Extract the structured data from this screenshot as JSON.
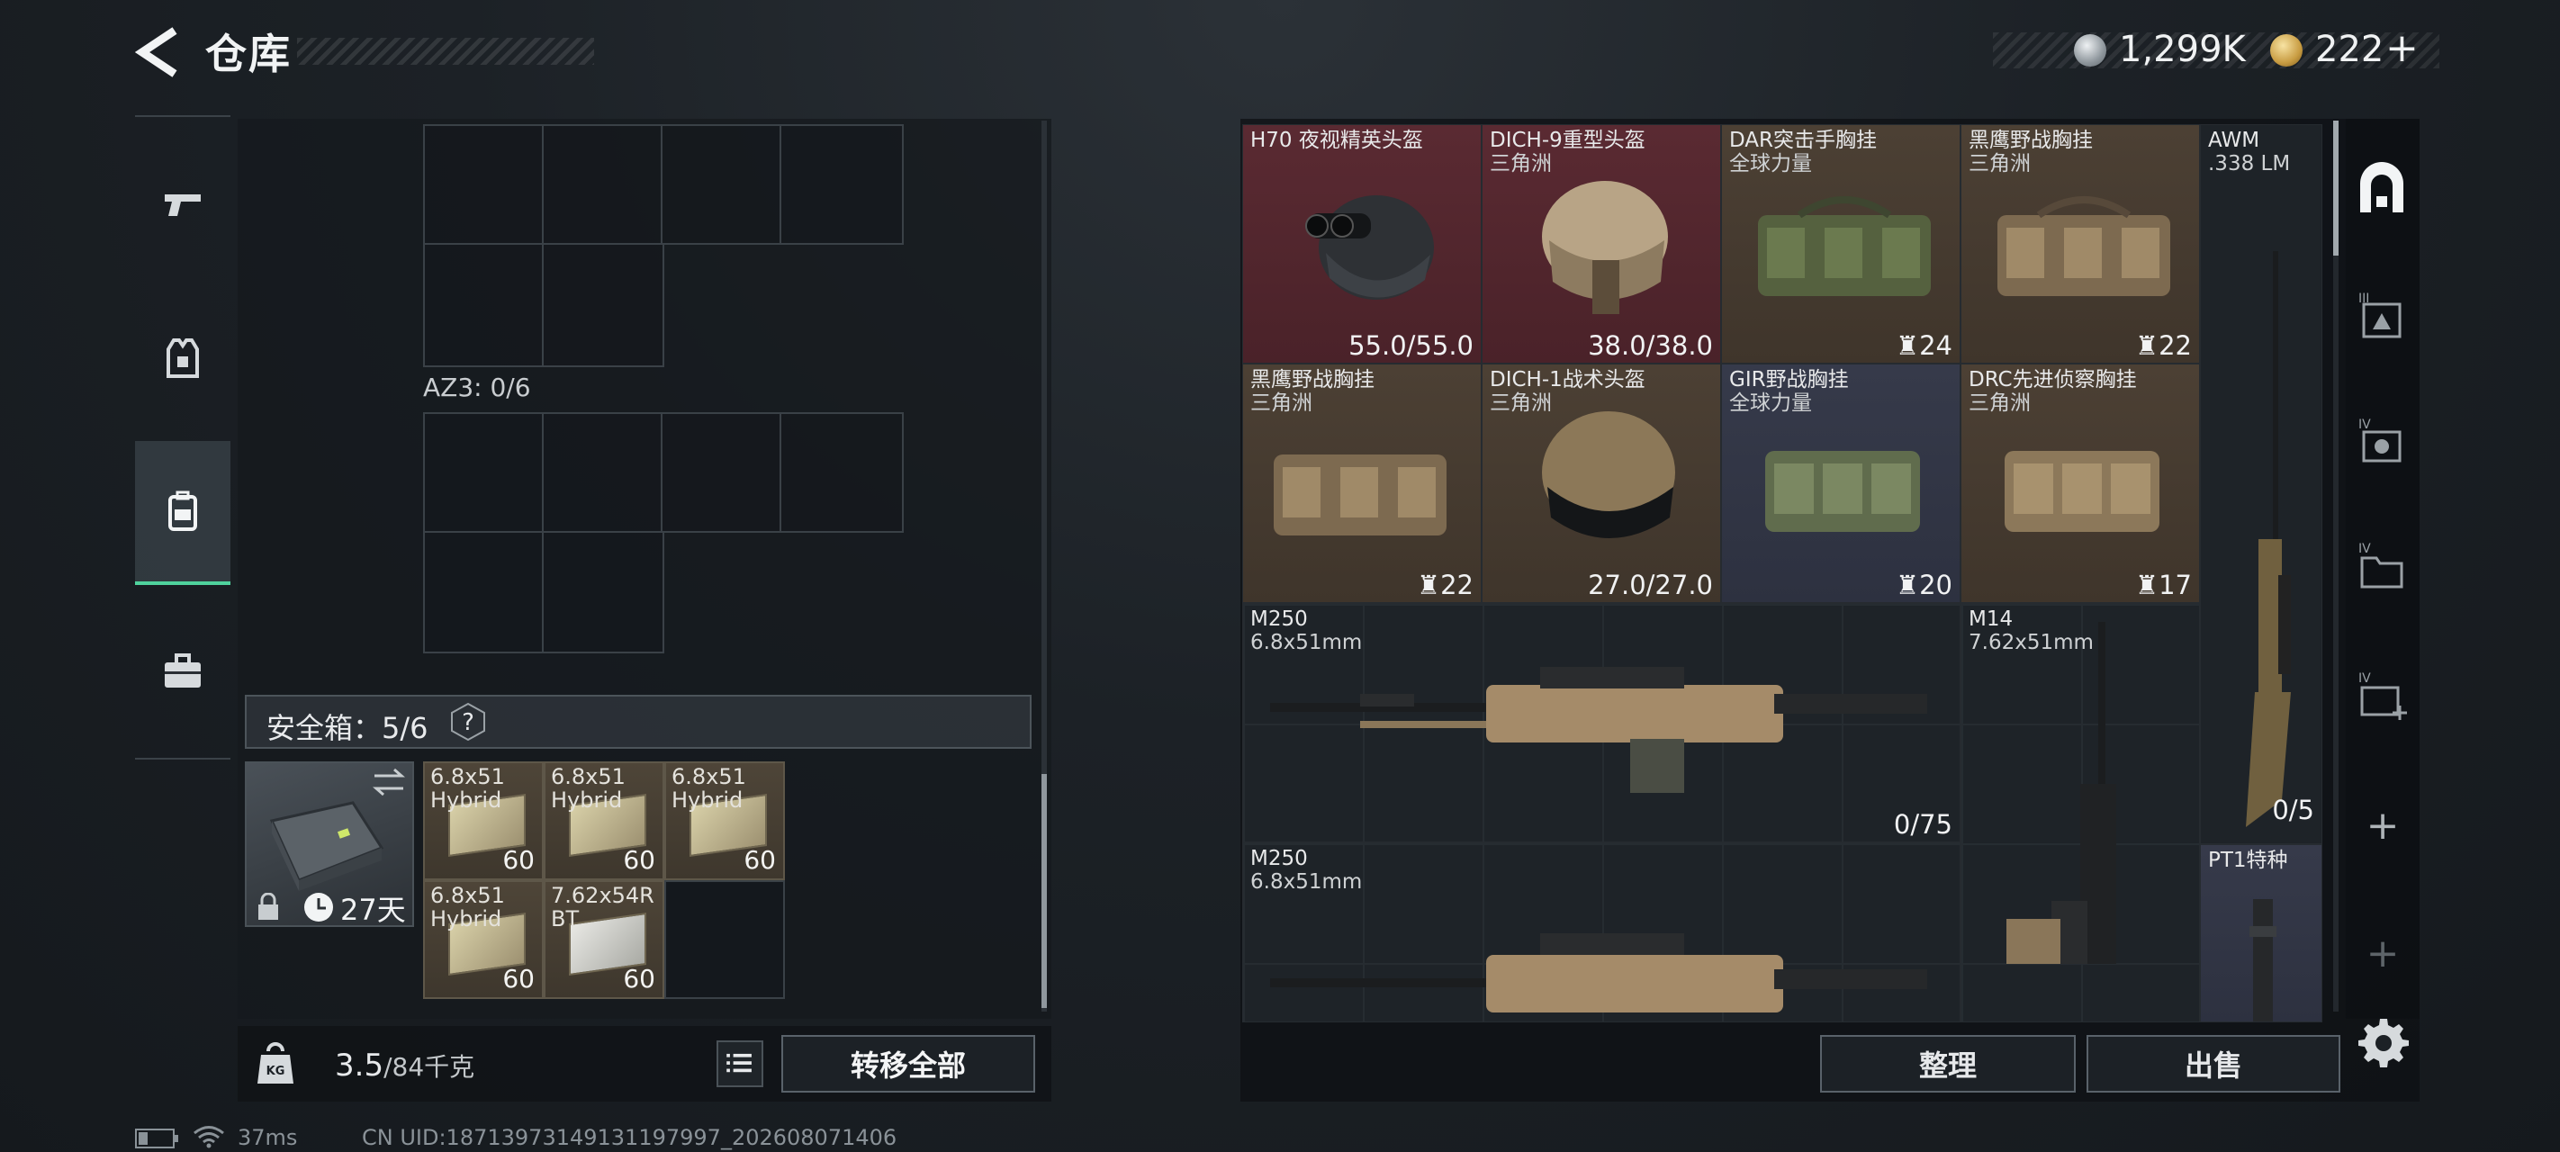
{
  "header": {
    "title": "仓库",
    "currency_silver": "1,299K",
    "currency_gold": "222",
    "currency_gold_add": "+"
  },
  "left_nav": {
    "items": [
      {
        "name": "weapon",
        "icon": "pistol-icon"
      },
      {
        "name": "armor",
        "icon": "vest-icon"
      },
      {
        "name": "backpack",
        "icon": "backpack-icon",
        "active": true
      },
      {
        "name": "case",
        "icon": "briefcase-icon"
      }
    ]
  },
  "container": {
    "az3_label": "AZ3: 0/6",
    "safe_label": "安全箱：5/6",
    "safe_help": "?",
    "safebox_days": "27天",
    "ammo": [
      {
        "name": "6.8x51\nHybrid",
        "qty": "60"
      },
      {
        "name": "6.8x51\nHybrid",
        "qty": "60"
      },
      {
        "name": "6.8x51\nHybrid",
        "qty": "60"
      },
      {
        "name": "6.8x51\nHybrid",
        "qty": "60"
      },
      {
        "name": "7.62x54R\nBT",
        "qty": "60"
      }
    ]
  },
  "footer_left": {
    "weight_current": "3.5",
    "weight_max": "/84千克",
    "transfer_all": "转移全部"
  },
  "stash": {
    "items": [
      {
        "name1": "H70 夜视精英头盔",
        "name2": "",
        "value": "55.0/55.0",
        "rarity": "red"
      },
      {
        "name1": "DICH-9重型头盔",
        "name2": "三角洲",
        "value": "38.0/38.0",
        "rarity": "red"
      },
      {
        "name1": "DAR突击手胸挂",
        "name2": "全球力量",
        "value": "24",
        "rarity": "brown"
      },
      {
        "name1": "黑鹰野战胸挂",
        "name2": "三角洲",
        "value": "22",
        "rarity": "brown"
      },
      {
        "name1": "AWM",
        "name2": ".338 LM",
        "value": "0/5",
        "rarity": "dark"
      },
      {
        "name1": "黑鹰野战胸挂",
        "name2": "三角洲",
        "value": "22",
        "rarity": "brown"
      },
      {
        "name1": "DICH-1战术头盔",
        "name2": "三角洲",
        "value": "27.0/27.0",
        "rarity": "brown"
      },
      {
        "name1": "GIR野战胸挂",
        "name2": "全球力量",
        "value": "20",
        "rarity": "slate"
      },
      {
        "name1": "DRC先进侦察胸挂",
        "name2": "三角洲",
        "value": "17",
        "rarity": "brown"
      },
      {
        "name1": "M250",
        "name2": "6.8x51mm",
        "value": "0/75",
        "rarity": "dark"
      },
      {
        "name1": "M14",
        "name2": "7.62x51mm",
        "value": "",
        "rarity": "dark"
      },
      {
        "name1": "M250",
        "name2": "6.8x51mm",
        "value": "",
        "rarity": "dark"
      },
      {
        "name1": "PT1特种",
        "name2": "",
        "value": "",
        "rarity": "slate"
      }
    ]
  },
  "footer_right": {
    "sort": "整理",
    "sell": "出售"
  },
  "right_nav": {
    "plus_1": "+",
    "plus_2": "+"
  },
  "status": {
    "ping": "37ms",
    "uid": "CN UID:18713973149131197997_202608071406"
  }
}
